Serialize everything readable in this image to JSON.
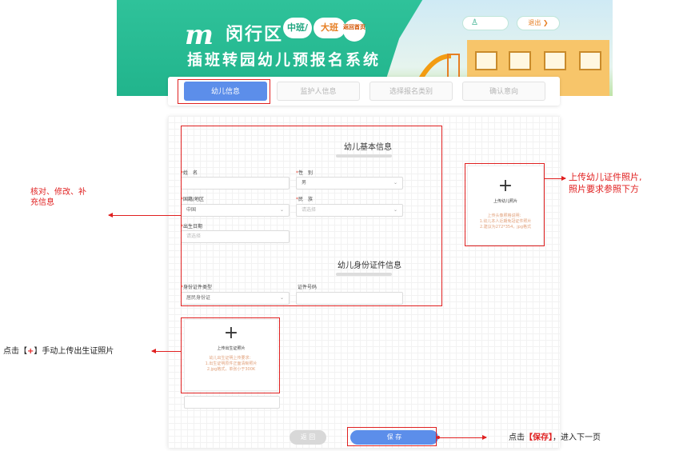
{
  "banner": {
    "logo": "m",
    "district": "闵行区",
    "badge_middle": "中班/",
    "badge_large": "大班",
    "home_label": "返回首页",
    "system_title": "插班转园幼儿预报名系统",
    "user_name": "",
    "exit_label": "退出 ❯"
  },
  "steps": [
    {
      "label": "幼儿信息"
    },
    {
      "label": "监护人信息"
    },
    {
      "label": "选择报名类别"
    },
    {
      "label": "确认意向"
    }
  ],
  "basic_info": {
    "title": "幼儿基本信息",
    "name_label": "姓　名",
    "name_value": "",
    "gender_label": "性　别",
    "gender_value": "男",
    "nationality_label": "国籍/地区",
    "nationality_value": "中国",
    "ethnicity_label": "民　族",
    "ethnicity_placeholder": "请选择",
    "birthdate_label": "出生日期",
    "birthdate_placeholder": "请选择"
  },
  "id_info": {
    "title": "幼儿身份证件信息",
    "id_type_label": "身份证件类型",
    "id_type_value": "居民身份证",
    "id_number_label": "证件号码",
    "id_number_value": ""
  },
  "photo_upload": {
    "plus": "+",
    "title": "上传幼儿照片",
    "tip_line1": "上传头像照格说明：",
    "tip_line2": "1.幼儿本人近期免冠证件照片",
    "tip_line3": "2.建议为272*354，jpg格式"
  },
  "birth_cert_upload": {
    "plus": "+",
    "title": "上传出生证照片",
    "tip_line1": "幼儿出生证明上传要求：",
    "tip_line2": "1.出生证明原件正面清晰照片",
    "tip_line3": "2.jpg格式，单张小于300K"
  },
  "buttons": {
    "back_label": "返 回",
    "save_label": "保 存"
  },
  "annotations": {
    "verify_line1": "核对、修改、补",
    "verify_line2": "充信息",
    "photo_line1": "上传幼儿证件照片,",
    "photo_line2": "照片要求参照下方",
    "birth_prefix": "点击【",
    "birth_plus": "+",
    "birth_suffix": "】手动上传出生证照片",
    "save_prefix": "点击",
    "save_bold": "【保存】",
    "save_suffix": "，进入下一页"
  },
  "colors": {
    "banner_green": "#21b48c",
    "step_active": "#5c8eea",
    "annotation_red": "#e02020"
  }
}
